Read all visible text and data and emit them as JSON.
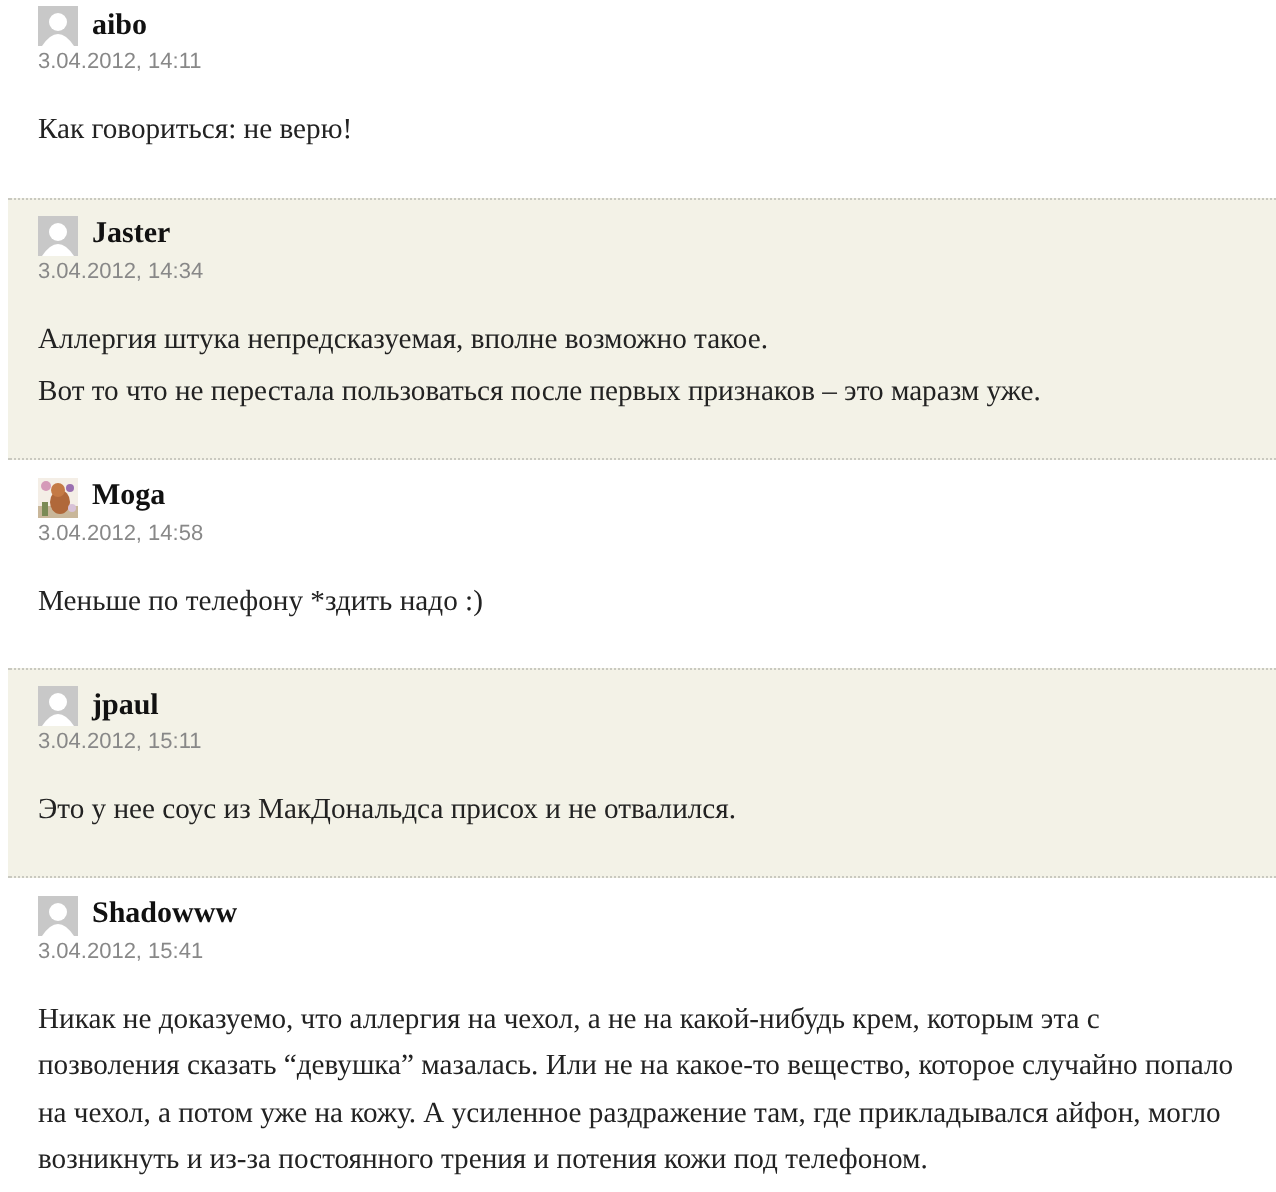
{
  "comments": [
    {
      "author": "aibo",
      "avatar": {
        "kind": "default"
      },
      "date": "3.04.2012, 14:11",
      "shaded": false,
      "lines": [
        "Как говориться: не верю!"
      ]
    },
    {
      "author": "Jaster",
      "avatar": {
        "kind": "default"
      },
      "date": "3.04.2012, 14:34",
      "shaded": true,
      "lines": [
        "Аллергия штука непредсказуемая, вполне возможно такое.",
        "Вот то что не перестала пользоваться после первых признаков – это маразм уже."
      ]
    },
    {
      "author": "Moga",
      "avatar": {
        "kind": "picture"
      },
      "date": "3.04.2012, 14:58",
      "shaded": false,
      "lines": [
        "Меньше по телефону *здить надо :)"
      ]
    },
    {
      "author": "jpaul",
      "avatar": {
        "kind": "default"
      },
      "date": "3.04.2012, 15:11",
      "shaded": true,
      "lines": [
        "Это у нее соус из МакДональдса присох и не отвалился."
      ]
    },
    {
      "author": "Shadowww",
      "avatar": {
        "kind": "default"
      },
      "date": "3.04.2012, 15:41",
      "shaded": false,
      "lines": [
        "Никак не доказуемо, что аллергия на чехол, а не на какой-нибудь крем, которым эта с позволения сказать “девушка” мазалась. Или не на какое-то вещество, которое случайно попало на чехол, а потом уже на кожу. А усиленное раздражение там, где прикладывался айфон, могло возникнуть и из-за постоянного трения и потения кожи под телефоном."
      ]
    }
  ]
}
